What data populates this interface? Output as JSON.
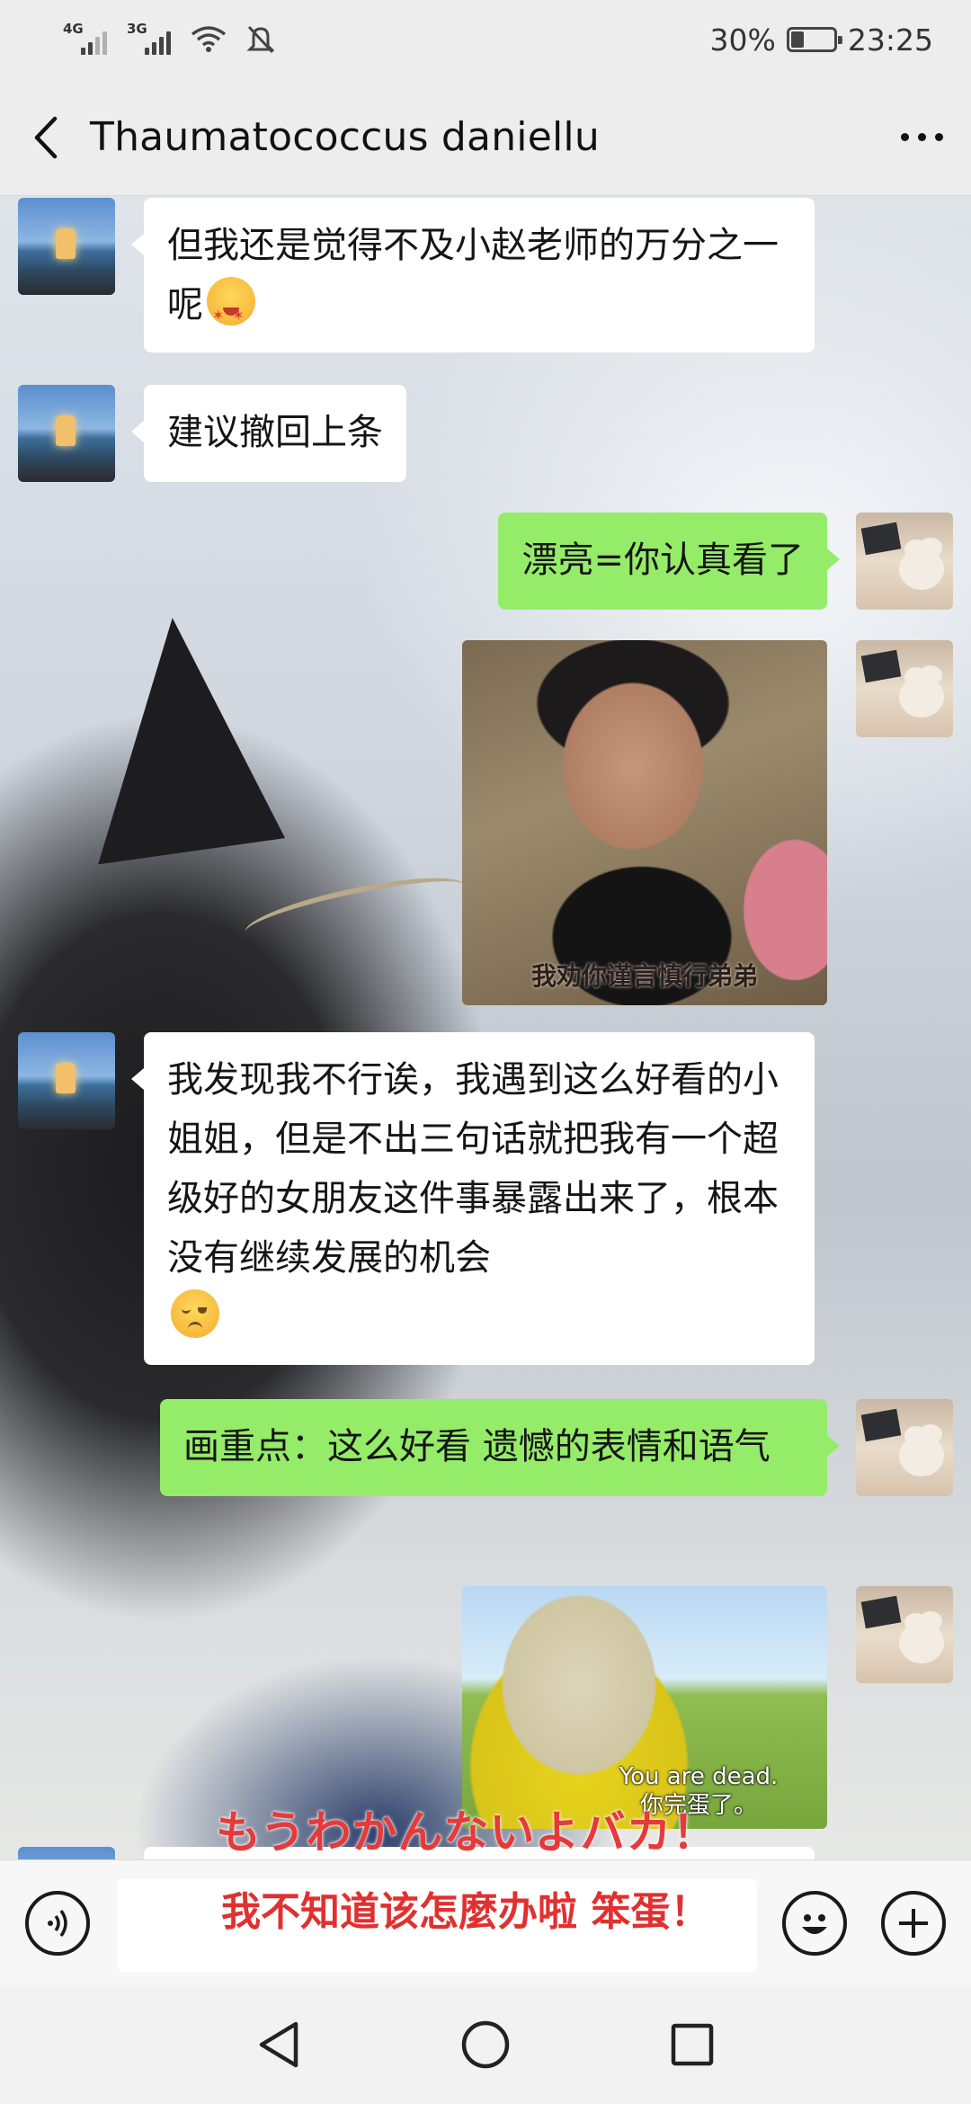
{
  "status_bar": {
    "net1": "4G",
    "net2": "3G",
    "battery_level": "30%",
    "battery_fraction": 0.3,
    "time": "23:25",
    "icons": [
      "signal-icon",
      "signal-icon",
      "wifi-icon",
      "mute-icon",
      "battery-icon"
    ]
  },
  "header": {
    "title": "Thaumatococcus daniellu",
    "back_icon": "chevron-left-icon",
    "more_icon": "more-dots-icon"
  },
  "messages": [
    {
      "from": "friend",
      "type": "text",
      "text": "但我还是觉得不及小赵老师的万分之一呢",
      "emoji": "star-struck-emoji"
    },
    {
      "from": "friend",
      "type": "text",
      "text": "建议撤回上条"
    },
    {
      "from": "me",
      "type": "text",
      "text": "漂亮=你认真看了"
    },
    {
      "from": "me",
      "type": "image",
      "caption": "我劝你谨言慎行弟弟"
    },
    {
      "from": "friend",
      "type": "text",
      "text": "我发现我不行诶，我遇到这么好看的小姐姐，但是不出三句话就把我有一个超级好的女朋友这件事暴露出来了，根本没有继续发展的机会",
      "emoji": "pensive-emoji"
    },
    {
      "from": "me",
      "type": "text",
      "text": "画重点：这么好看 遗憾的表情和语气"
    },
    {
      "from": "me",
      "type": "image",
      "caption_line1": "You are dead.",
      "caption_line2": "你完蛋了。"
    }
  ],
  "overlay": {
    "jp": "もうわかんないよバカ！",
    "cn": "我不知道该怎麼办啦 笨蛋！"
  },
  "input_bar": {
    "voice_icon": "voice-icon",
    "emoji_icon": "smiley-icon",
    "plus_icon": "plus-icon",
    "input_value": ""
  },
  "nav_bar": {
    "icons": [
      "back-triangle-icon",
      "home-circle-icon",
      "recents-square-icon"
    ]
  },
  "colors": {
    "bubble_me": "#95ec69",
    "bubble_friend": "#ffffff",
    "overlay_red": "#e63a3a"
  }
}
